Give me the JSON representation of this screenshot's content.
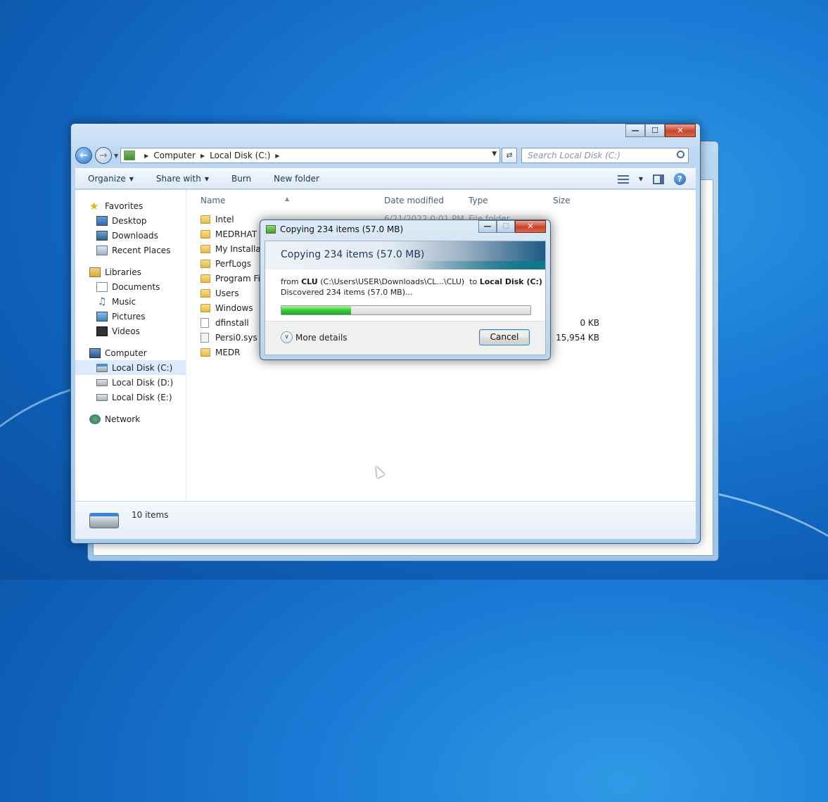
{
  "explorer": {
    "caption_buttons": [
      "—",
      "☐",
      "✕"
    ],
    "breadcrumb": [
      "Computer",
      "Local Disk (C:)"
    ],
    "search_placeholder": "Search Local Disk (C:)",
    "toolbar": {
      "organize": "Organize",
      "share_with": "Share with",
      "burn": "Burn",
      "new_folder": "New folder"
    },
    "nav": {
      "favorites": "Favorites",
      "desktop": "Desktop",
      "downloads": "Downloads",
      "recent_places": "Recent Places",
      "libraries": "Libraries",
      "documents": "Documents",
      "music": "Music",
      "pictures": "Pictures",
      "videos": "Videos",
      "computer": "Computer",
      "local_c": "Local Disk (C:)",
      "local_d": "Local Disk (D:)",
      "local_e": "Local Disk (E:)",
      "network": "Network"
    },
    "columns": {
      "name": "Name",
      "date_modified": "Date modified",
      "type": "Type",
      "size": "Size"
    },
    "files": [
      {
        "name": "Intel",
        "kind": "folder"
      },
      {
        "name": "MEDRHAT",
        "kind": "folder"
      },
      {
        "name": "My Installati",
        "kind": "folder"
      },
      {
        "name": "PerfLogs",
        "kind": "folder"
      },
      {
        "name": "Program File",
        "kind": "folder"
      },
      {
        "name": "Users",
        "kind": "folder"
      },
      {
        "name": "Windows",
        "kind": "folder"
      },
      {
        "name": "dfinstall",
        "kind": "file",
        "size": "0 KB"
      },
      {
        "name": "Persi0.sys",
        "kind": "system",
        "size": "15,954 KB"
      },
      {
        "name": "MEDR",
        "kind": "folder"
      }
    ],
    "first_row_date_partial": "6/21/2022 0:01 PM",
    "first_row_type_partial": "File folder",
    "status_count": "10 items"
  },
  "copy_dialog": {
    "title": "Copying 234 items (57.0 MB)",
    "heading": "Copying 234 items (57.0 MB)",
    "from_label": "from",
    "source_name": "CLU",
    "source_path": "(C:\\Users\\USER\\Downloads\\CL...\\CLU)",
    "to_label": "to",
    "dest": "Local Disk (C:)",
    "discovered": "Discovered 234 items (57.0 MB)...",
    "progress_fraction": 0.28,
    "more_details": "More details",
    "cancel": "Cancel"
  }
}
